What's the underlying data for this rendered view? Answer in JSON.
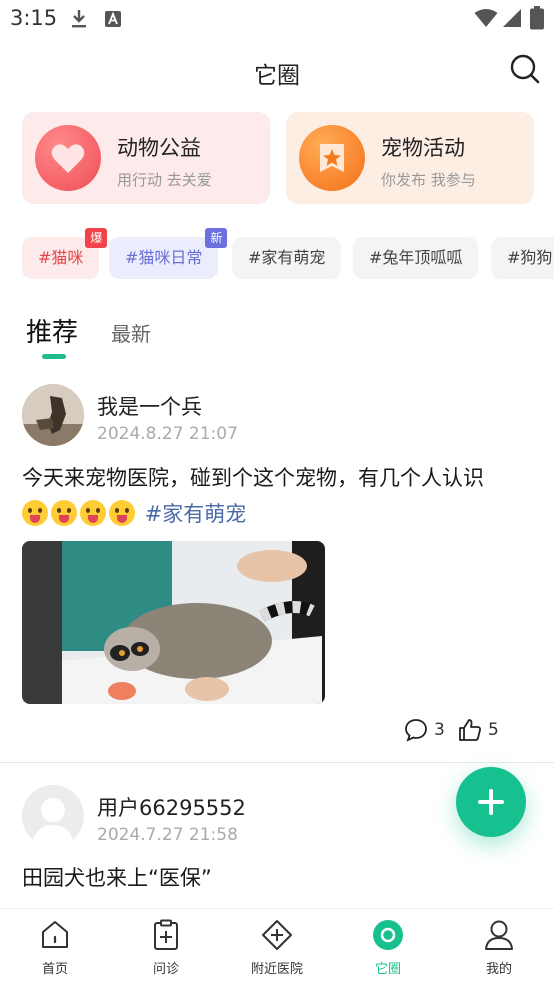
{
  "status_bar": {
    "time": "3:15",
    "icons": [
      "download-icon",
      "font-icon",
      "wifi-icon",
      "signal-icon",
      "battery-icon"
    ]
  },
  "header": {
    "title": "它圈",
    "search_icon": "search-icon"
  },
  "feature_cards": [
    {
      "title": "动物公益",
      "subtitle": "用行动 去关爱",
      "icon": "heart-icon",
      "color": "#f04e55"
    },
    {
      "title": "宠物活动",
      "subtitle": "你发布 我参与",
      "icon": "star-card-icon",
      "color": "#fa7a1c"
    }
  ],
  "tags": [
    {
      "label": "#猫咪",
      "badge": "爆",
      "text_color": "#e9454b",
      "bg": "#fdebeb",
      "badge_color": "#f0444a"
    },
    {
      "label": "#猫咪日常",
      "badge": "新",
      "text_color": "#6a6fd6",
      "bg": "#ecedfc",
      "badge_color": "#6b6fe0"
    },
    {
      "label": "#家有萌宠",
      "badge": "",
      "text_color": "#444444",
      "bg": "#f3f4f6"
    },
    {
      "label": "#兔年顶呱呱",
      "badge": "",
      "text_color": "#444444",
      "bg": "#f3f4f6"
    },
    {
      "label": "#狗狗",
      "badge": "",
      "text_color": "#444444",
      "bg": "#f3f4f6"
    }
  ],
  "tabs": {
    "active": "推荐",
    "inactive": "最新"
  },
  "posts": [
    {
      "author": "我是一个兵",
      "time": "2024.8.27 21:07",
      "text": "今天来宠物医院，碰到个这个宠物，有几个人认识",
      "emoji_count": 4,
      "topic": "#家有萌宠",
      "comments": "3",
      "likes": "5"
    },
    {
      "author": "用户66295552",
      "time": "2024.7.27 21:58",
      "text": "田园犬也来上“医保”"
    }
  ],
  "fab": {
    "icon": "plus-icon"
  },
  "bottom_nav": [
    {
      "label": "首页",
      "icon": "home-icon"
    },
    {
      "label": "问诊",
      "icon": "clipboard-plus-icon"
    },
    {
      "label": "附近医院",
      "icon": "hospital-icon"
    },
    {
      "label": "它圈",
      "icon": "circle-icon",
      "active": true
    },
    {
      "label": "我的",
      "icon": "user-icon"
    }
  ],
  "colors": {
    "accent": "#17c08f",
    "topic": "#4a6aa8"
  }
}
